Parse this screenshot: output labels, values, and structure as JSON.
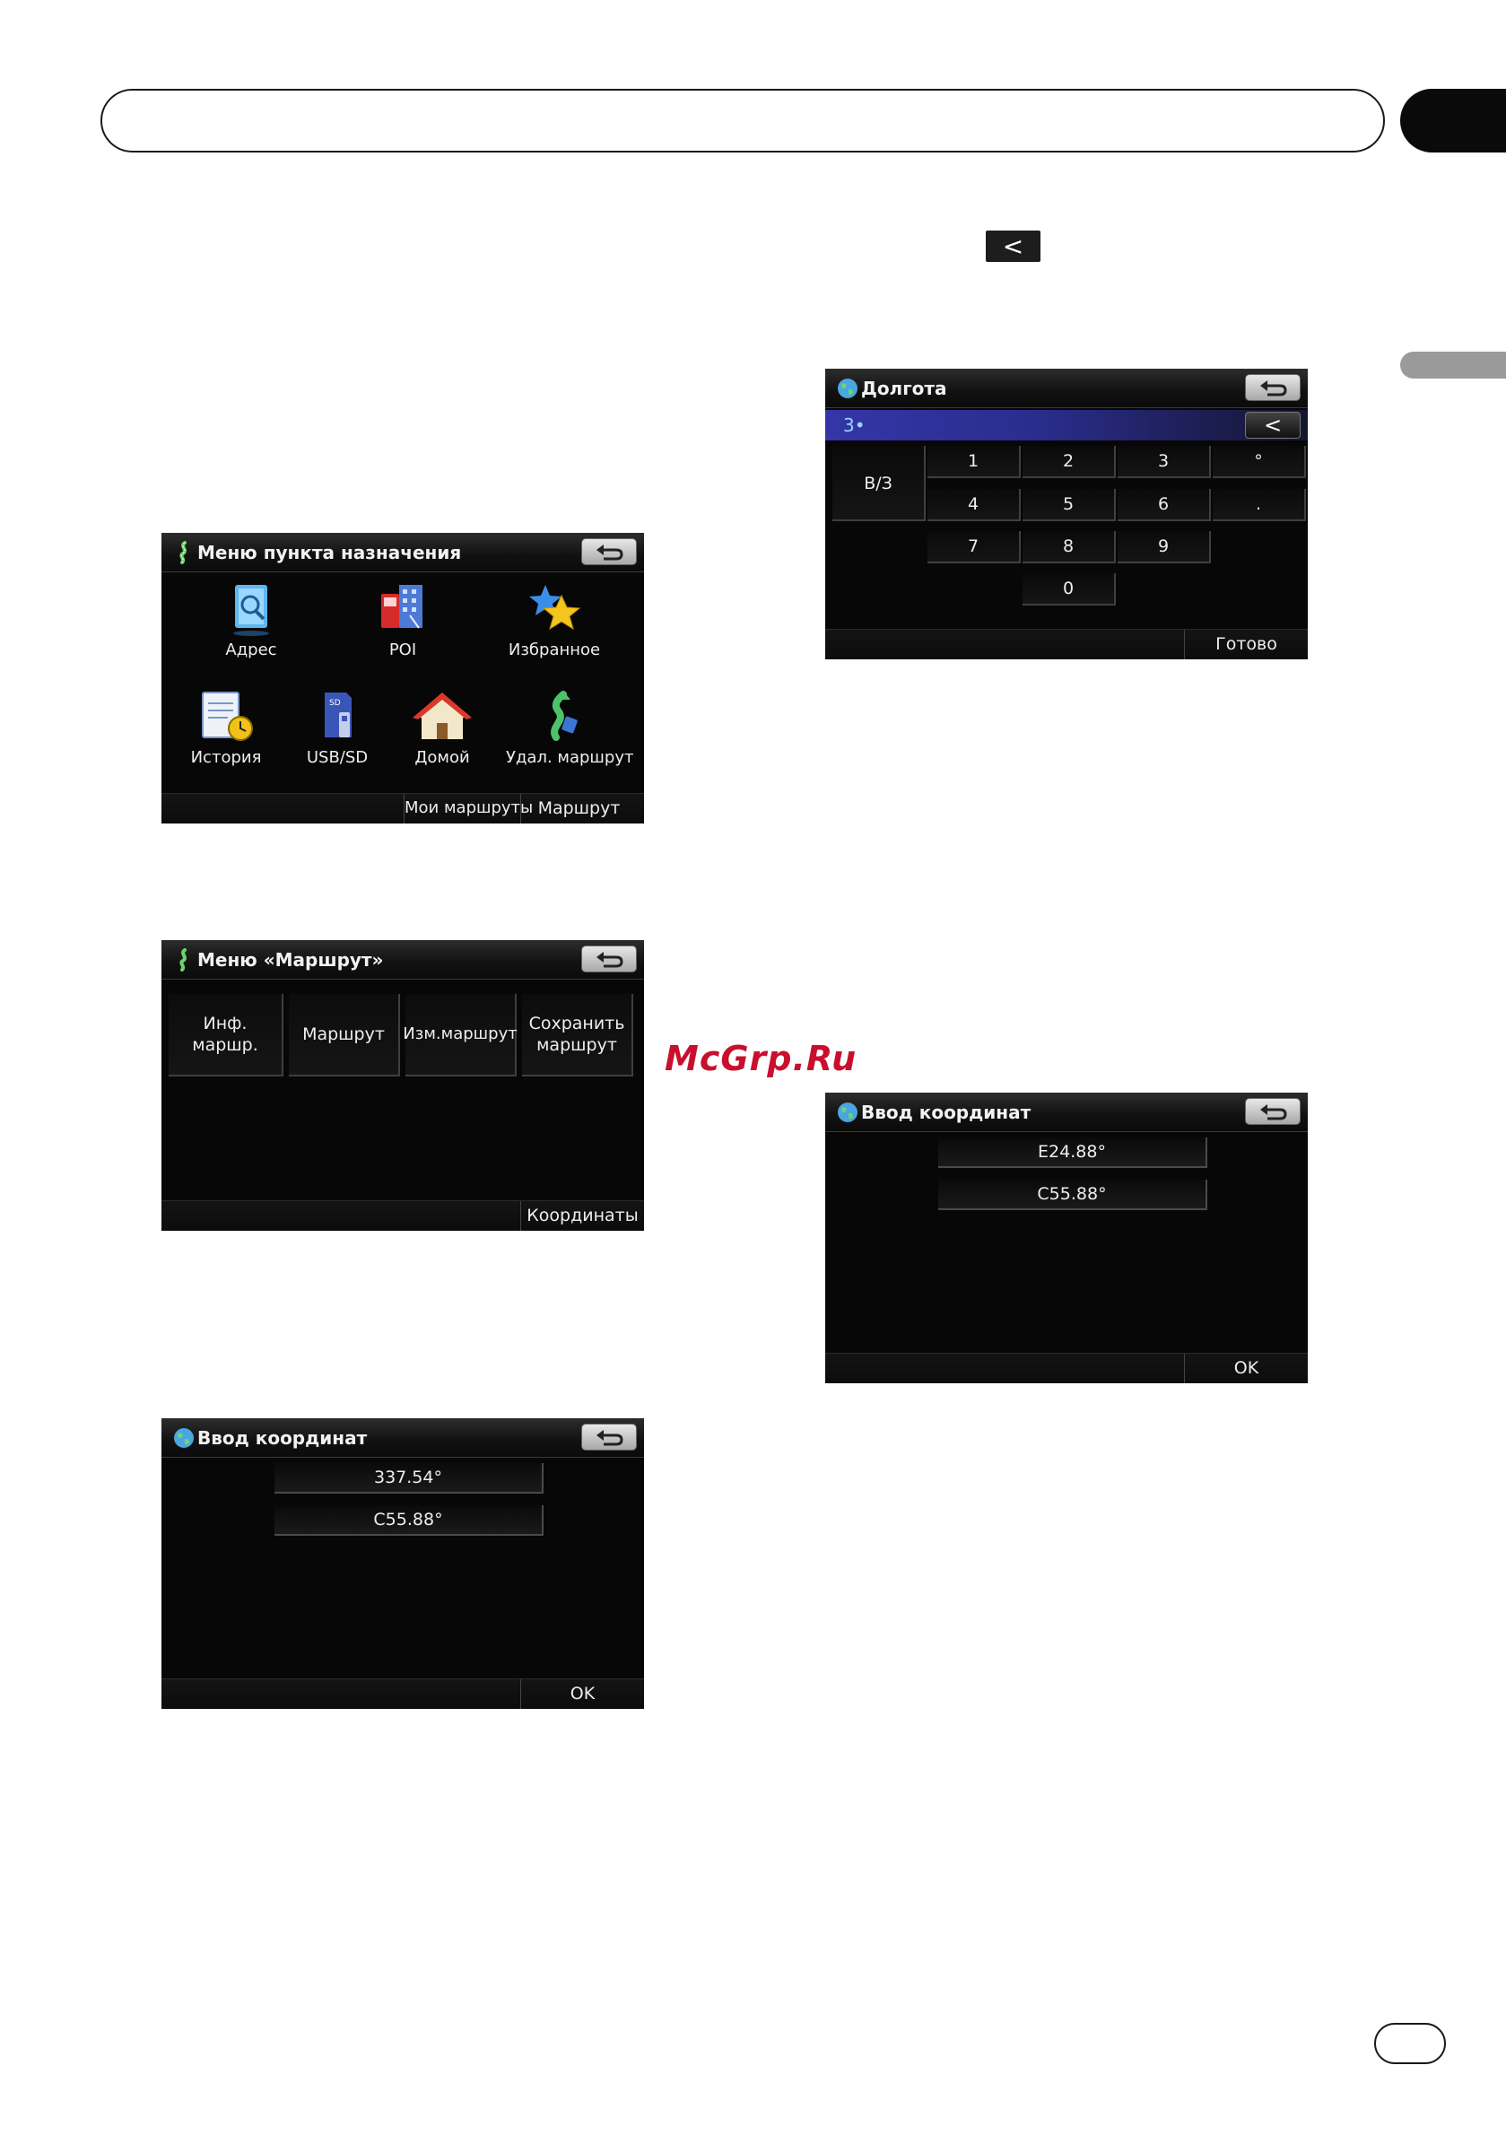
{
  "page": {
    "small_back_glyph": "<",
    "watermark": "McGrp.Ru"
  },
  "screen_destination": {
    "title": "Меню пункта назначения",
    "items": [
      {
        "label": "Адрес",
        "icon": "address-book-icon"
      },
      {
        "label": "POI",
        "icon": "poi-buildings-icon"
      },
      {
        "label": "Избранное",
        "icon": "favorites-stars-icon"
      },
      {
        "label": "История",
        "icon": "history-clock-icon"
      },
      {
        "label": "USB/SD",
        "icon": "sd-card-icon"
      },
      {
        "label": "Домой",
        "icon": "home-icon"
      },
      {
        "label": "Удал. маршрут",
        "icon": "delete-route-icon"
      }
    ],
    "bottom": [
      "Мои маршруты",
      "Маршрут"
    ]
  },
  "screen_route_menu": {
    "title": "Меню «Маршрут»",
    "buttons": [
      "Инф. маршр.",
      "Маршрут",
      "Изм.маршрут",
      "Сохранить маршрут"
    ],
    "bottom": "Координаты"
  },
  "screen_coords_left": {
    "title": "Ввод координат",
    "fields": [
      "337.54°",
      "С55.88°"
    ],
    "ok": "OK"
  },
  "screen_longitude": {
    "title": "Долгота",
    "input_value": "3•",
    "delete_glyph": "<",
    "dir_key": "В/З",
    "keys": [
      "1",
      "2",
      "3",
      "°",
      "4",
      "5",
      "6",
      ".",
      "7",
      "8",
      "9",
      "0"
    ],
    "done": "Готово"
  },
  "screen_coords_right": {
    "title": "Ввод координат",
    "fields": [
      "E24.88°",
      "С55.88°"
    ],
    "ok": "OK"
  },
  "colors": {
    "screen_bg": "#070707",
    "input_highlight": "#3436a8",
    "watermark": "#c8102e"
  }
}
